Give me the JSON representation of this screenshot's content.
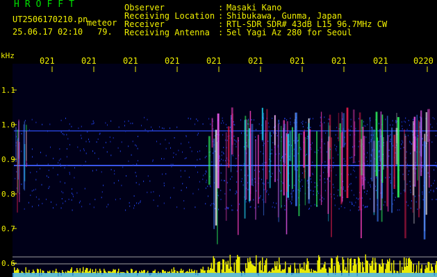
{
  "app_title": "HROFFT",
  "file_name": "UT2506170210.pn",
  "meteor_label": "meteor",
  "date_time": "25.06.17 02:10",
  "meteor_count": "79.",
  "info": [
    {
      "label": "Observer",
      "value": "Masaki Kano"
    },
    {
      "label": "Receiving Location",
      "value": "Shibukawa, Gunma, Japan"
    },
    {
      "label": "Receiver",
      "value": "RTL-SDR SDR# 43dB L15 96.7MHz CW"
    },
    {
      "label": "Receiving Antenna",
      "value": "5el Yagi Az 280 for Seoul"
    }
  ],
  "y_unit": "kHz",
  "x_ticks": [
    "021",
    "021",
    "021",
    "021",
    "021",
    "021",
    "021",
    "021",
    "021",
    "0220"
  ],
  "y_ticks": [
    "1.1",
    "1.0",
    "0.9",
    "0.8",
    "0.7",
    "0.6"
  ],
  "colors": {
    "label_green": "#00e000",
    "label_yellow": "#f0f000",
    "background": "#000000"
  }
}
